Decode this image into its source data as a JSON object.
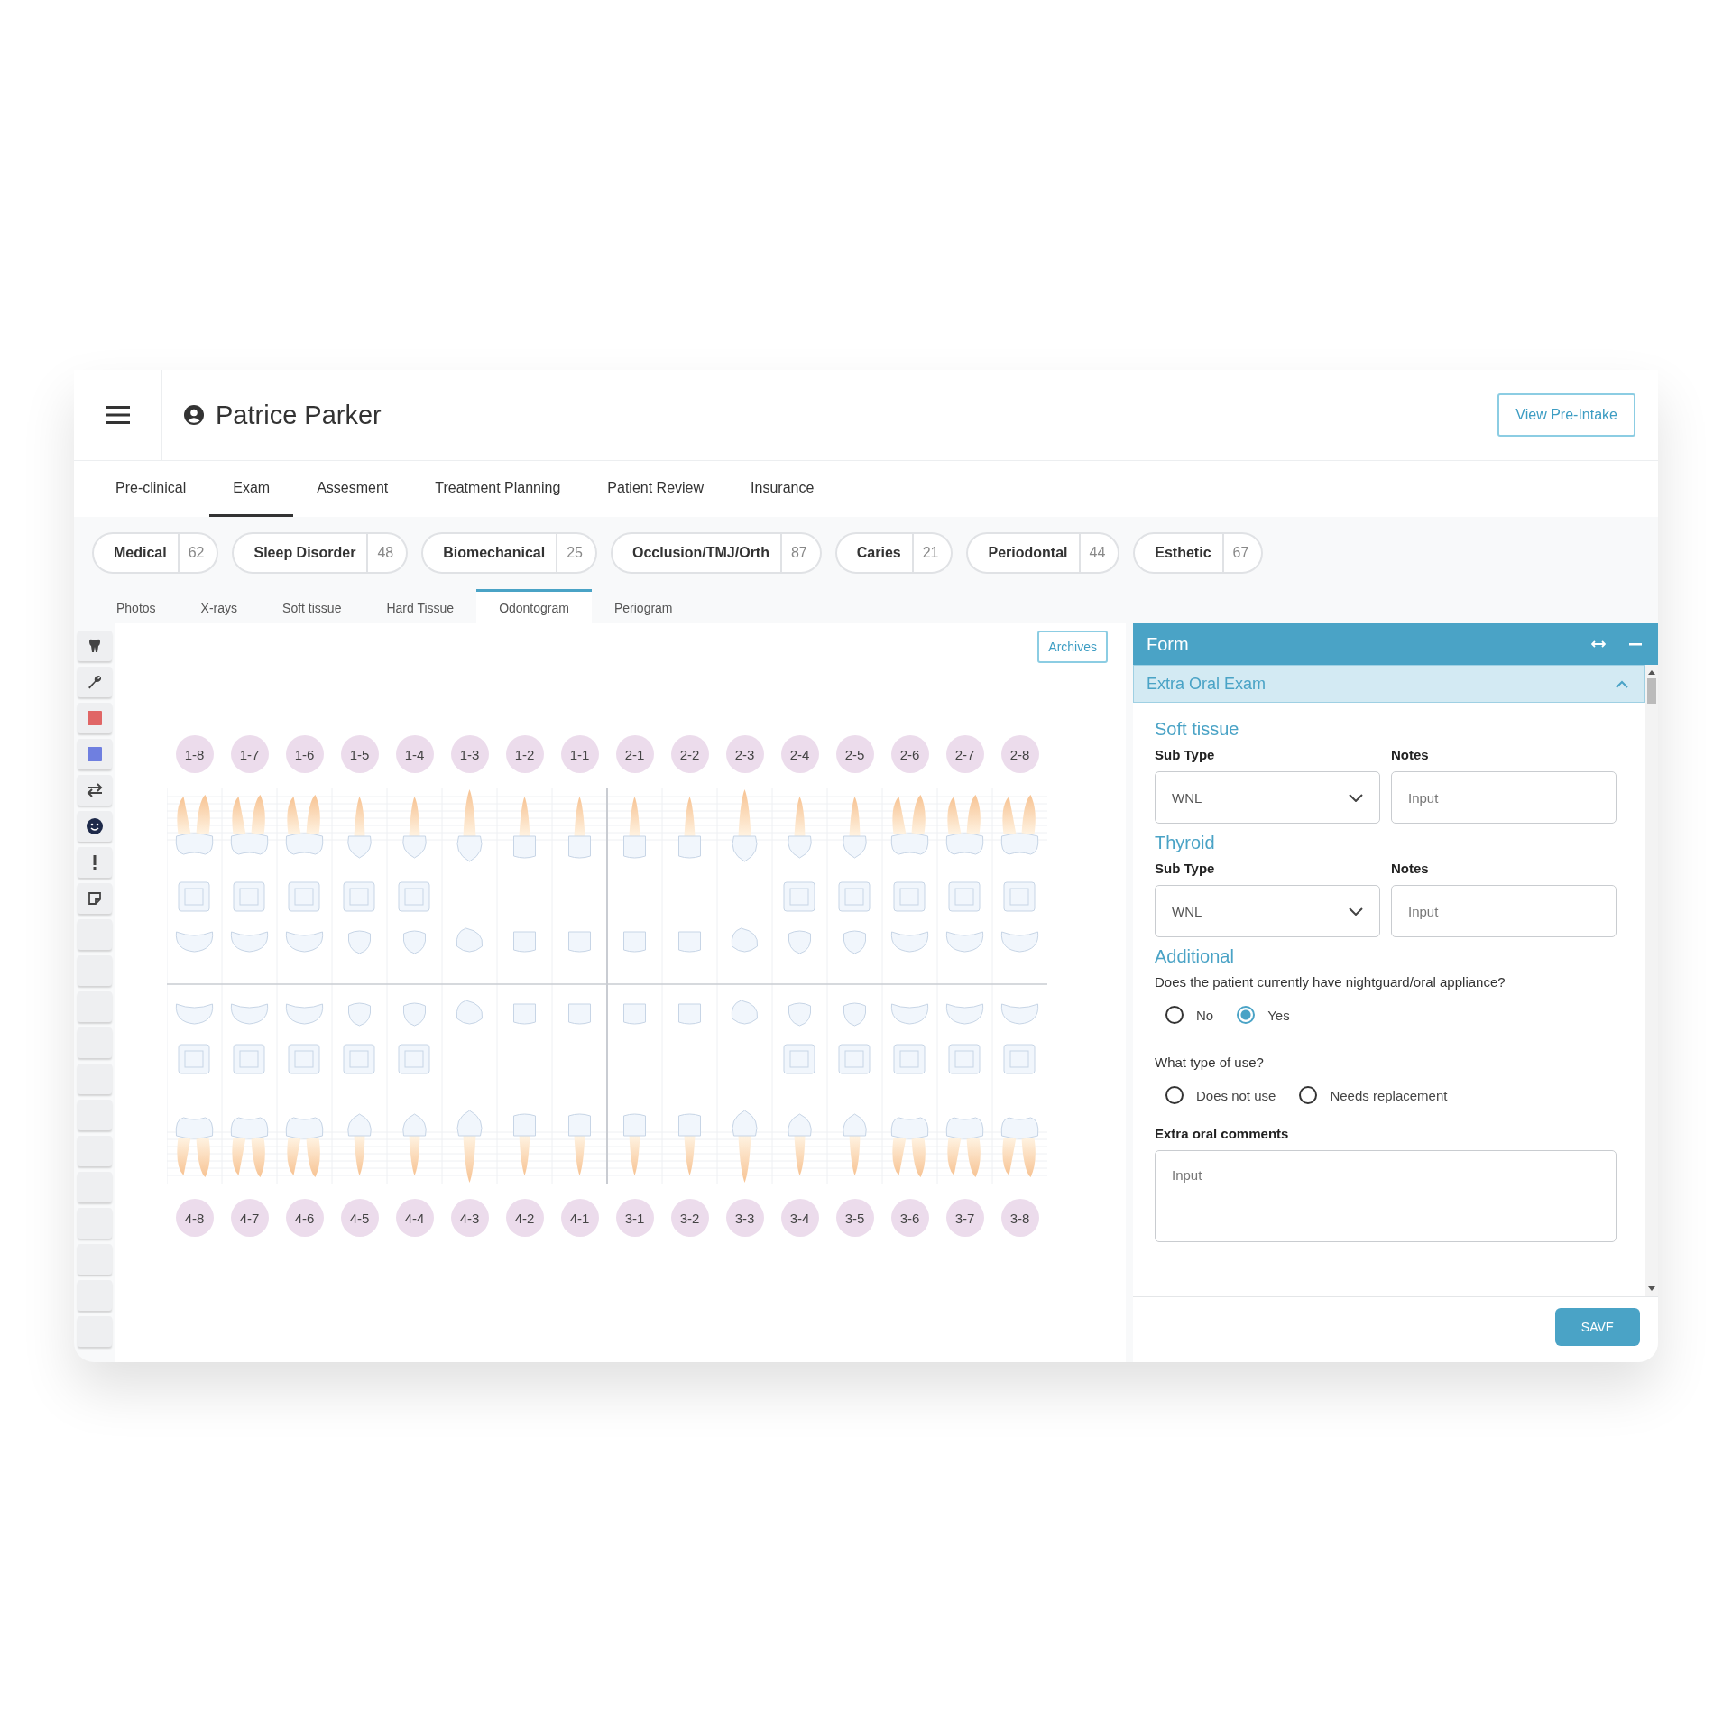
{
  "header": {
    "patient_name": "Patrice Parker",
    "action_button": "View Pre-Intake"
  },
  "tabs": [
    {
      "label": "Pre-clinical",
      "selected": false
    },
    {
      "label": "Exam",
      "selected": true
    },
    {
      "label": "Assesment",
      "selected": false
    },
    {
      "label": "Treatment Planning",
      "selected": false
    },
    {
      "label": "Patient Review",
      "selected": false
    },
    {
      "label": "Insurance",
      "selected": false
    }
  ],
  "categories": [
    {
      "label": "Medical",
      "count": "62"
    },
    {
      "label": "Sleep Disorder",
      "count": "48"
    },
    {
      "label": "Biomechanical",
      "count": "25"
    },
    {
      "label": "Occlusion/TMJ/Orth",
      "count": "87"
    },
    {
      "label": "Caries",
      "count": "21"
    },
    {
      "label": "Periodontal",
      "count": "44"
    },
    {
      "label": "Esthetic",
      "count": "67"
    }
  ],
  "sub_tabs": [
    {
      "label": "Photos",
      "selected": false
    },
    {
      "label": "X-rays",
      "selected": false
    },
    {
      "label": "Soft tissue",
      "selected": false
    },
    {
      "label": "Hard Tissue",
      "selected": false
    },
    {
      "label": "Odontogram",
      "selected": true
    },
    {
      "label": "Periogram",
      "selected": false
    }
  ],
  "toolbar": {
    "tools": [
      {
        "kind": "tooth"
      },
      {
        "kind": "wrench"
      },
      {
        "kind": "swatch",
        "color": "#e06666"
      },
      {
        "kind": "swatch",
        "color": "#6f7fe0"
      },
      {
        "kind": "swap"
      },
      {
        "kind": "smiley"
      },
      {
        "kind": "alert"
      },
      {
        "kind": "note"
      },
      {
        "kind": "empty"
      },
      {
        "kind": "empty"
      },
      {
        "kind": "empty"
      },
      {
        "kind": "empty"
      },
      {
        "kind": "empty"
      },
      {
        "kind": "empty"
      },
      {
        "kind": "empty"
      },
      {
        "kind": "empty"
      },
      {
        "kind": "empty"
      },
      {
        "kind": "empty"
      },
      {
        "kind": "empty"
      },
      {
        "kind": "empty"
      }
    ]
  },
  "odontogram": {
    "archives_button": "Archives",
    "upper_teeth": [
      {
        "label": "1-8",
        "kind": "molar"
      },
      {
        "label": "1-7",
        "kind": "molar"
      },
      {
        "label": "1-6",
        "kind": "molar"
      },
      {
        "label": "1-5",
        "kind": "premolar"
      },
      {
        "label": "1-4",
        "kind": "premolar"
      },
      {
        "label": "1-3",
        "kind": "canine"
      },
      {
        "label": "1-2",
        "kind": "incisor"
      },
      {
        "label": "1-1",
        "kind": "incisor"
      },
      {
        "label": "2-1",
        "kind": "incisor"
      },
      {
        "label": "2-2",
        "kind": "incisor"
      },
      {
        "label": "2-3",
        "kind": "canine"
      },
      {
        "label": "2-4",
        "kind": "premolar"
      },
      {
        "label": "2-5",
        "kind": "premolar"
      },
      {
        "label": "2-6",
        "kind": "molar"
      },
      {
        "label": "2-7",
        "kind": "molar"
      },
      {
        "label": "2-8",
        "kind": "molar"
      }
    ],
    "lower_teeth": [
      {
        "label": "4-8",
        "kind": "molar"
      },
      {
        "label": "4-7",
        "kind": "molar"
      },
      {
        "label": "4-6",
        "kind": "molar"
      },
      {
        "label": "4-5",
        "kind": "premolar"
      },
      {
        "label": "4-4",
        "kind": "premolar"
      },
      {
        "label": "4-3",
        "kind": "canine"
      },
      {
        "label": "4-2",
        "kind": "incisor"
      },
      {
        "label": "4-1",
        "kind": "incisor"
      },
      {
        "label": "3-1",
        "kind": "incisor"
      },
      {
        "label": "3-2",
        "kind": "incisor"
      },
      {
        "label": "3-3",
        "kind": "canine"
      },
      {
        "label": "3-4",
        "kind": "premolar"
      },
      {
        "label": "3-5",
        "kind": "premolar"
      },
      {
        "label": "3-6",
        "kind": "molar"
      },
      {
        "label": "3-7",
        "kind": "molar"
      },
      {
        "label": "3-8",
        "kind": "molar"
      }
    ]
  },
  "form": {
    "title": "Form",
    "section": {
      "title": "Extra Oral Exam",
      "expanded": true
    },
    "groups": [
      {
        "title": "Soft tissue",
        "subtype_label": "Sub Type",
        "subtype_value": "WNL",
        "notes_label": "Notes",
        "notes_placeholder": "Input"
      },
      {
        "title": "Thyroid",
        "subtype_label": "Sub Type",
        "subtype_value": "WNL",
        "notes_label": "Notes",
        "notes_placeholder": "Input"
      }
    ],
    "additional": {
      "title": "Additional",
      "questions": [
        {
          "text": "Does the patient currently have nightguard/oral appliance?",
          "options": [
            {
              "label": "No",
              "selected": false
            },
            {
              "label": "Yes",
              "selected": true
            }
          ]
        },
        {
          "text": "What type of use?",
          "options": [
            {
              "label": "Does not use",
              "selected": false
            },
            {
              "label": "Needs replacement",
              "selected": false
            }
          ]
        }
      ]
    },
    "comments": {
      "label": "Extra oral comments",
      "placeholder": "Input"
    },
    "save_button": "SAVE"
  }
}
